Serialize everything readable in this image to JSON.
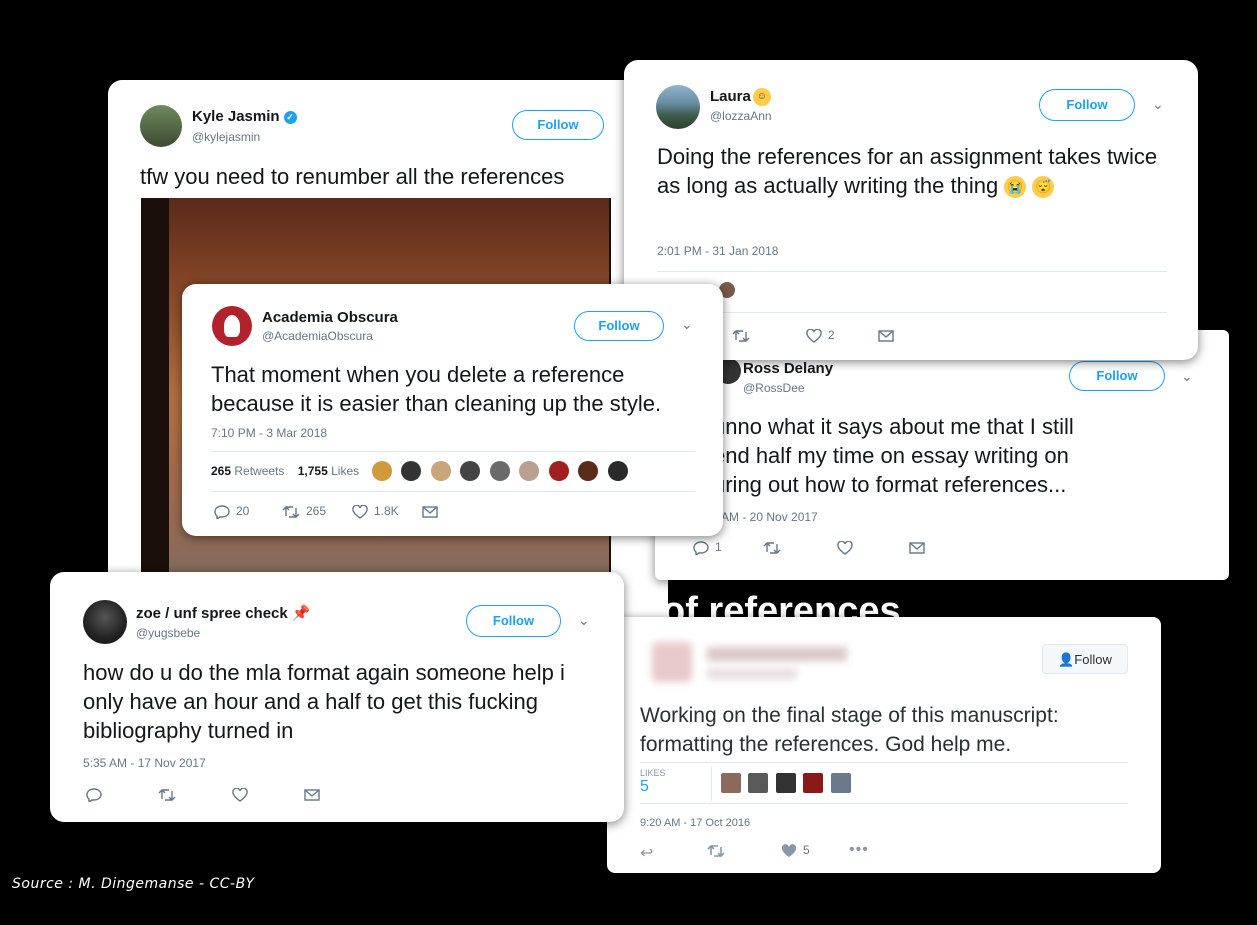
{
  "kyle": {
    "name": "Kyle Jasmin",
    "handle": "@kylejasmin",
    "follow": "Follow",
    "text": "tfw you need to renumber all the references"
  },
  "laura": {
    "name": "Laura",
    "handle": "@lozzaAnn",
    "follow": "Follow",
    "text": "Doing the references for an assignment takes twice as long as actually writing the thing",
    "timestamp": "2:01 PM - 31 Jan 2018",
    "likes": "2"
  },
  "academia": {
    "name": "Academia Obscura",
    "handle": "@AcademiaObscura",
    "follow": "Follow",
    "text": "That moment when you delete a reference because it is easier than cleaning up the style.",
    "timestamp": "7:10 PM - 3 Mar 2018",
    "retweets_num": "265",
    "retweets_label": "Retweets",
    "likes_num": "1,755",
    "likes_label": "Likes",
    "replies": "20",
    "rts": "265",
    "favs": "1.8K"
  },
  "ross": {
    "name": "Ross Delany",
    "handle": "@RossDee",
    "follow": "Follow",
    "text_line1": "unno what it says about me that I still",
    "text_line2": "end half my time on essay writing on",
    "text_line3": "uring out how to format references...",
    "timestamp": "AM - 20 Nov 2017",
    "replies": "1"
  },
  "zoe": {
    "name": "zoe / unf spree check",
    "handle": "@yugsbebe",
    "follow": "Follow",
    "text": "how do u do the mla format again someone help i only have an hour and a half to get this fucking bibliography turned in",
    "timestamp": "5:35 AM - 17 Nov 2017"
  },
  "old": {
    "follow": "Follow",
    "text": "Working on the final stage of this manuscript: formatting the references. God help me.",
    "likes_label": "LIKES",
    "likes_num": "5",
    "timestamp": "9:20 AM - 17 Oct 2016",
    "favs": "5"
  },
  "caption": "of references",
  "source": "Source : M. Dingemanse - CC-BY"
}
